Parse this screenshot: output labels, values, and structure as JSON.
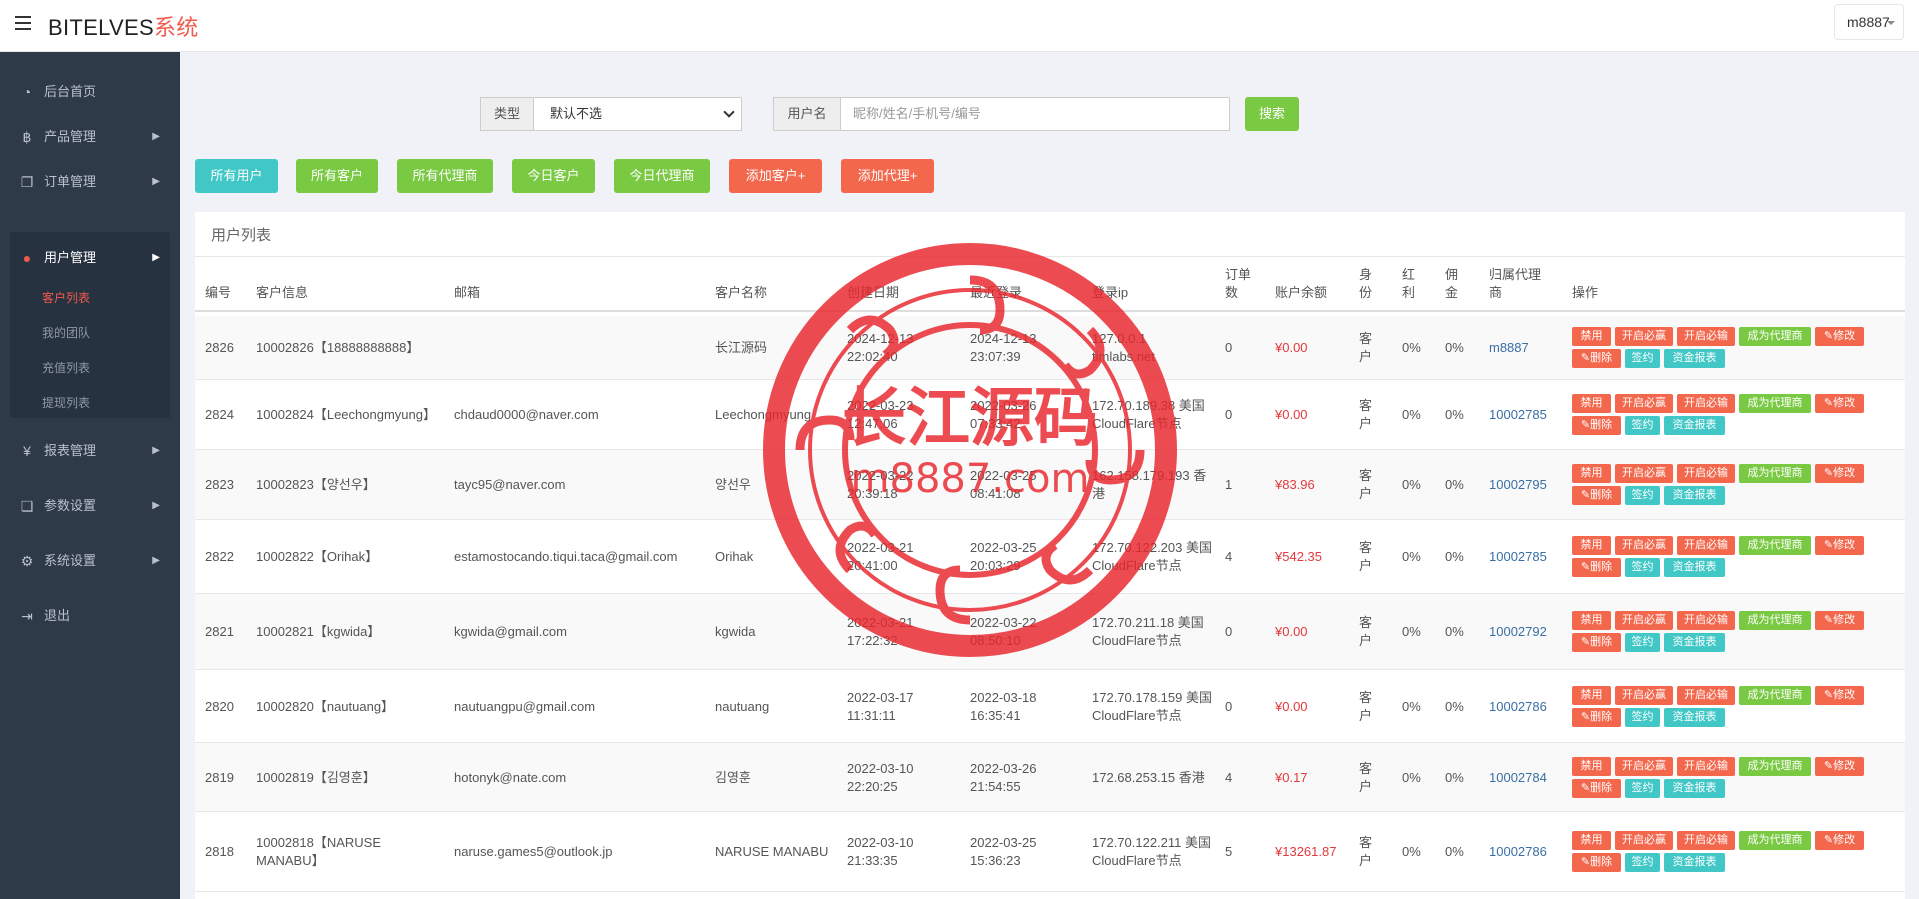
{
  "brand": {
    "name": "BITELVES",
    "suffix": "系统"
  },
  "user_menu": {
    "label": "m8887"
  },
  "sidebar": {
    "items": [
      {
        "label": "后台首页",
        "icon": "dashboard-icon"
      },
      {
        "label": "产品管理",
        "icon": "bitcoin-icon"
      },
      {
        "label": "订单管理",
        "icon": "copy-icon"
      },
      {
        "label": "用户管理",
        "icon": "user-icon"
      },
      {
        "label": "报表管理",
        "icon": "yen-icon"
      },
      {
        "label": "参数设置",
        "icon": "files-icon"
      },
      {
        "label": "系统设置",
        "icon": "cogs-icon"
      },
      {
        "label": "退出",
        "icon": "sign-out-icon"
      }
    ],
    "subitems": [
      "客户列表",
      "我的团队",
      "充值列表",
      "提现列表"
    ]
  },
  "search": {
    "type_label": "类型",
    "type_value": "默认不选",
    "user_label": "用户名",
    "user_placeholder": "昵称/姓名/手机号/编号",
    "search_button": "搜索"
  },
  "filters": [
    "所有用户",
    "所有客户",
    "所有代理商",
    "今日客户",
    "今日代理商",
    "添加客户+",
    "添加代理+"
  ],
  "panel_title": "用户列表",
  "columns": [
    "编号",
    "客户信息",
    "邮箱",
    "客户名称",
    "创建日期",
    "最近登录",
    "登录ip",
    "订单数",
    "账户余额",
    "身份",
    "红利",
    "佣金",
    "归属代理商",
    "操作"
  ],
  "actions": [
    "禁用",
    "开启必赢",
    "开启必输",
    "成为代理商",
    "修改",
    "删除",
    "签约",
    "资金报表"
  ],
  "rows": [
    {
      "id": "2826",
      "info": "10002826【18888888888】",
      "email": "",
      "name": "长江源码",
      "created": "2024-12-13 22:02:40",
      "last_login": "2024-12-13 23:07:39",
      "ip": "127.0.0.1 timlabs.net",
      "orders": "0",
      "balance": "¥0.00",
      "role": "客户",
      "bonus": "0%",
      "commission": "0%",
      "agent": "m8887"
    },
    {
      "id": "2824",
      "info": "10002824【Leechongmyung】",
      "email": "chdaud0000@naver.com",
      "name": "Leechongmyung",
      "created": "2022-03-23 12:47:06",
      "last_login": "2022-03-26 07:33:42",
      "ip": "172.70.189.38 美国CloudFlare节点",
      "orders": "0",
      "balance": "¥0.00",
      "role": "客户",
      "bonus": "0%",
      "commission": "0%",
      "agent": "10002785"
    },
    {
      "id": "2823",
      "info": "10002823【양선우】",
      "email": "tayc95@naver.com",
      "name": "양선우",
      "created": "2022-03-22 20:39:18",
      "last_login": "2022-03-25 08:41:08",
      "ip": "162.158.179.193 香港",
      "orders": "1",
      "balance": "¥83.96",
      "role": "客户",
      "bonus": "0%",
      "commission": "0%",
      "agent": "10002795"
    },
    {
      "id": "2822",
      "info": "10002822【Orihak】",
      "email": "estamostocando.tiqui.taca@gmail.com",
      "name": "Orihak",
      "created": "2022-03-21 20:41:00",
      "last_login": "2022-03-25 20:03:29",
      "ip": "172.70.122.203 美国CloudFlare节点",
      "orders": "4",
      "balance": "¥542.35",
      "role": "客户",
      "bonus": "0%",
      "commission": "0%",
      "agent": "10002785"
    },
    {
      "id": "2821",
      "info": "10002821【kgwida】",
      "email": "kgwida@gmail.com",
      "name": "kgwida",
      "created": "2022-03-21 17:22:32",
      "last_login": "2022-03-22 08:50:10",
      "ip": "172.70.211.18 美国CloudFlare节点",
      "orders": "0",
      "balance": "¥0.00",
      "role": "客户",
      "bonus": "0%",
      "commission": "0%",
      "agent": "10002792"
    },
    {
      "id": "2820",
      "info": "10002820【nautuang】",
      "email": "nautuangpu@gmail.com",
      "name": "nautuang",
      "created": "2022-03-17 11:31:11",
      "last_login": "2022-03-18 16:35:41",
      "ip": "172.70.178.159 美国CloudFlare节点",
      "orders": "0",
      "balance": "¥0.00",
      "role": "客户",
      "bonus": "0%",
      "commission": "0%",
      "agent": "10002786"
    },
    {
      "id": "2819",
      "info": "10002819【김영훈】",
      "email": "hotonyk@nate.com",
      "name": "김영훈",
      "created": "2022-03-10 22:20:25",
      "last_login": "2022-03-26 21:54:55",
      "ip": "172.68.253.15 香港",
      "orders": "4",
      "balance": "¥0.17",
      "role": "客户",
      "bonus": "0%",
      "commission": "0%",
      "agent": "10002784"
    },
    {
      "id": "2818",
      "info": "10002818【NARUSE MANABU】",
      "email": "naruse.games5@outlook.jp",
      "name": "NARUSE MANABU",
      "created": "2022-03-10 21:33:35",
      "last_login": "2022-03-25 15:36:23",
      "ip": "172.70.122.211 美国CloudFlare节点",
      "orders": "5",
      "balance": "¥13261.87",
      "role": "客户",
      "bonus": "0%",
      "commission": "0%",
      "agent": "10002786"
    }
  ],
  "watermark": {
    "title": "长江源码",
    "url": "m8887.com"
  },
  "colors": {
    "accent": "#f0594c",
    "green": "#7ac943",
    "teal": "#41c7c6",
    "red": "#f3674d",
    "sidebar": "#2f3a48",
    "money": "#e4393c",
    "link": "#3a6ea5"
  }
}
